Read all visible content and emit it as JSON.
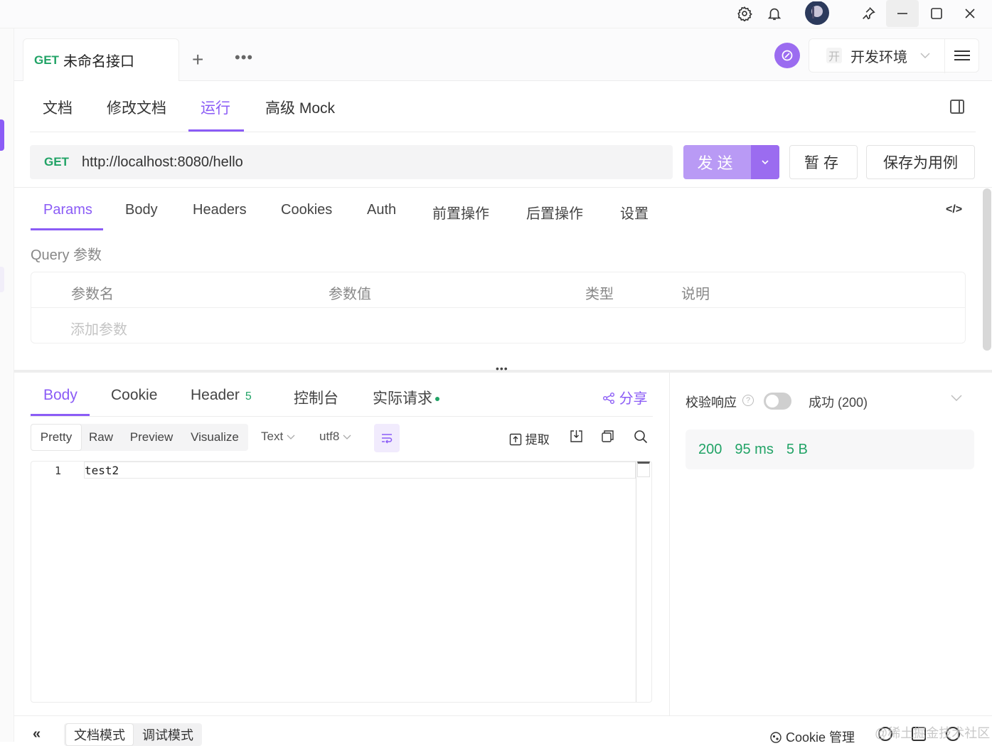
{
  "titlebar": {
    "icons": [
      "gear-icon",
      "bell-icon",
      "avatar",
      "pin-icon",
      "minimize-icon",
      "maximize-icon",
      "close-icon"
    ]
  },
  "tabbar": {
    "tab_method": "GET",
    "tab_title": "未命名接口",
    "add_icon": "+",
    "more_icon": "•••",
    "env_badge": "开",
    "env_name": "开发环境"
  },
  "nav": {
    "tabs": [
      "文档",
      "修改文档",
      "运行",
      "高级 Mock"
    ],
    "active": "运行"
  },
  "request": {
    "method": "GET",
    "url": "http://localhost:8080/hello",
    "send_label": "发送",
    "save_label": "暂存",
    "save_case_label": "保存为用例"
  },
  "params_tabs": {
    "tabs": [
      "Params",
      "Body",
      "Headers",
      "Cookies",
      "Auth",
      "前置操作",
      "后置操作",
      "设置"
    ],
    "active": "Params",
    "code_icon": "</>"
  },
  "query": {
    "label": "Query 参数",
    "columns": [
      "参数名",
      "参数值",
      "类型",
      "说明"
    ],
    "add_placeholder": "添加参数"
  },
  "response": {
    "tabs": [
      "Body",
      "Cookie",
      "Header",
      "控制台",
      "实际请求"
    ],
    "header_count": "5",
    "active": "Body",
    "share_label": "分享",
    "formats": [
      "Pretty",
      "Raw",
      "Preview",
      "Visualize"
    ],
    "active_format": "Pretty",
    "content_type": "Text",
    "encoding": "utf8",
    "extract_label": "提取",
    "lines": [
      {
        "no": "1",
        "text": "test2"
      }
    ]
  },
  "validation": {
    "label": "校验响应",
    "result": "成功 (200)",
    "status": "200",
    "time": "95 ms",
    "size": "5 B"
  },
  "footer": {
    "collapse": "«",
    "modes": [
      "文档模式",
      "调试模式"
    ],
    "active_mode": "文档模式",
    "cookie_label": "Cookie 管理",
    "watermark": "@稀土掘金技术社区"
  },
  "colors": {
    "accent": "#8b5cf6",
    "get_green": "#21a366"
  }
}
